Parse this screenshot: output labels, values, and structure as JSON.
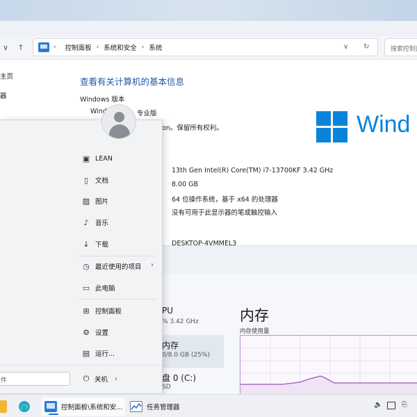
{
  "control_panel": {
    "breadcrumb": [
      "控制面板",
      "系统和安全",
      "系统"
    ],
    "search_placeholder": "搜索控制面板",
    "left_nav": [
      "主页",
      "器"
    ],
    "heading": "查看有关计算机的基本信息",
    "windows_edition_label": "Windows 版本",
    "edition_fragment": "Windo",
    "edition_suffix": "专业版",
    "copyright_fragment": "on。保留所有权利。",
    "processor": "13th Gen Intel(R) Core(TM) i7-13700KF   3.42 GHz",
    "ram": "8.00 GB",
    "system_type": "64 位操作系统，基于 x64 的处理器",
    "pen_touch": "没有可用于此显示器的笔或触控输入",
    "computer_name": "DESKTOP-4VMMEL3",
    "wordmark": "Wind"
  },
  "task_manager": {
    "cpu_label": "PU",
    "cpu_value": "% 3.42 GHz",
    "memory_label": "内存",
    "memory_value": "0/8.0 GB (25%)",
    "disk_label": "盘 0 (C:)",
    "disk_value": "SD",
    "title": "内存",
    "graph_label": "内存使用量"
  },
  "start_menu": {
    "items": [
      {
        "label": "LEAN",
        "icon": "user-folder-icon"
      },
      {
        "label": "文档",
        "icon": "document-icon"
      },
      {
        "label": "图片",
        "icon": "picture-icon"
      },
      {
        "label": "音乐",
        "icon": "music-icon"
      },
      {
        "label": "下载",
        "icon": "download-icon"
      },
      {
        "label": "最近使用的项目",
        "icon": "recent-icon"
      },
      {
        "label": "此电脑",
        "icon": "computer-icon"
      },
      {
        "label": "控制面板",
        "icon": "control-panel-icon"
      },
      {
        "label": "设置",
        "icon": "gear-icon"
      },
      {
        "label": "运行...",
        "icon": "run-icon"
      }
    ],
    "search_text": "件",
    "power_label": "关机"
  },
  "taskbar": {
    "apps": [
      {
        "label": "控制面板\\系统和安...",
        "icon": "control-panel-icon"
      },
      {
        "label": "任务管理器",
        "icon": "task-manager-icon"
      }
    ]
  },
  "colors": {
    "accent": "#0a84d8",
    "link": "#1c5aa6",
    "memory_graph": "#9b59b6"
  }
}
